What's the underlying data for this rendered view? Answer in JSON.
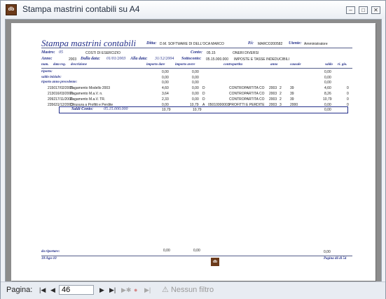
{
  "window": {
    "title": "Stampa mastrini contabili su A4",
    "icon": "access-report-icon"
  },
  "report": {
    "heading": "Stampa mastrini contabili",
    "ditta_label": "Ditta:",
    "ditta_value": "D.M. SOFTWARE DI DELL'OCA MARCO",
    "pi_label": "P.i:",
    "pi_value": "MARCO200582",
    "utente_label": "Utente:",
    "utente_value": "Amministratore",
    "mastro_label": "Mastro:",
    "mastro_value": "05",
    "mastro_desc": "COSTI DI ESERCIZIO",
    "conto_label": "Conto:",
    "conto_value": "05.15",
    "conto_desc": "ONERI DIVERSI",
    "anno_label": "Anno:",
    "anno_value": "2003",
    "dalla_label": "Dalla data:",
    "dalla_value": "01/01/2003",
    "alla_label": "Alla data:",
    "alla_value": "31/12/2004",
    "sottoconto_label": "Sottoconto:",
    "sottoconto_value": "05.15.000.000",
    "sottoconto_desc": "IMPOSTE E TASSE INDEDUCIBILI",
    "columns": [
      "num.",
      "data reg.",
      "descrizione",
      "importo dare",
      "importo avere",
      "contropartita",
      "anno",
      "causale",
      "saldo",
      "ri. gio."
    ],
    "summary_rows": [
      {
        "label": "riporto:",
        "dare": "0,00",
        "avere": "0,00",
        "saldo": "0,00"
      },
      {
        "label": "saldo iniziale:",
        "dare": "0,00",
        "avere": "0,00",
        "saldo": "0,00"
      },
      {
        "label": "riporto anno precedente:",
        "dare": "0,00",
        "avere": "0,00",
        "saldo": "0,00"
      }
    ],
    "entries": [
      {
        "num": "2150",
        "data": "17/02/2003",
        "desc": "Pagamento Modello 2003",
        "dare": "4,60",
        "avere": "0,00",
        "da": "D",
        "contro": "CONTROPARTITA CO",
        "anno": "2003",
        "c1": "2",
        "caus": "39",
        "saldo": "4,60",
        "ri": "0"
      },
      {
        "num": "2130",
        "data": "16/03/2003",
        "desc": "Pagamento M.a.V. n.",
        "dare": "3,64",
        "avere": "0,00",
        "da": "D",
        "contro": "CONTROPARTITA CO",
        "anno": "2003",
        "c1": "2",
        "caus": "39",
        "saldo": "8,26",
        "ri": "0"
      },
      {
        "num": "2092",
        "data": "17/11/2003",
        "desc": "Pagamento M.a.V. TR.",
        "dare": "2,33",
        "avere": "0,00",
        "da": "D",
        "contro": "CONTROPARTITA CO",
        "anno": "2003",
        "c1": "2",
        "caus": "39",
        "saldo": "10,79",
        "ri": "0"
      },
      {
        "num": "2356",
        "data": "31/12/2003",
        "desc": "Chiusura a Profitti e Perdite",
        "dare": "0,00",
        "avere": "10,79",
        "da": "A",
        "code": "05010000003",
        "contro": "PROFITTI E PERDITE",
        "anno": "2003",
        "c1": "3",
        "caus": "2000",
        "saldo": "0,00",
        "ri": "0"
      }
    ],
    "saldi_label": "Saldi Conto:",
    "saldi_value": "05.15.000.000",
    "saldi_dare": "10,79",
    "saldi_avere": "10,79",
    "saldi_saldo": "0,00",
    "riportare_label": "da riportare:",
    "riportare_dare": "0,00",
    "riportare_avere": "0,00",
    "riportare_saldo": "0,00",
    "footer_date": "18-Ago-10",
    "footer_page": "Pagina 46 di 54"
  },
  "navigation": {
    "label": "Pagina:",
    "current_page": "46",
    "filter_label": "Nessun filtro",
    "first": "|◀",
    "prev": "◀",
    "next": "▶",
    "last": "▶|",
    "new": "▶✱"
  }
}
